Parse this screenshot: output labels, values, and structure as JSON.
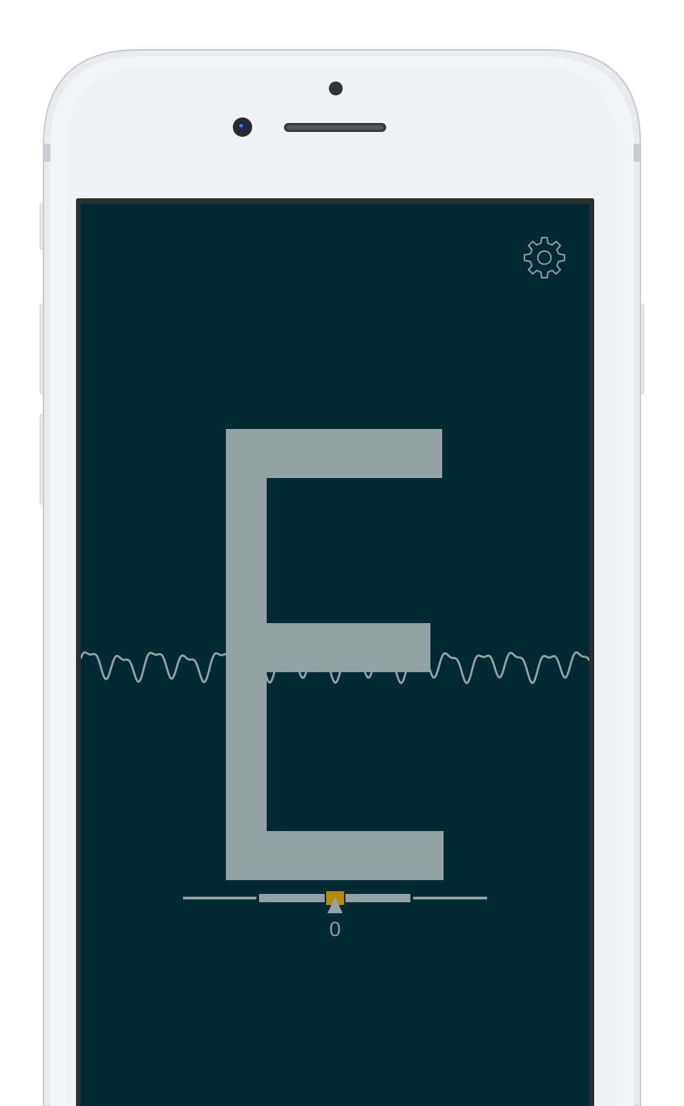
{
  "app": {
    "note": "E",
    "cents": "0",
    "icons": {
      "settings": "gear-icon",
      "indicator": "triangle-up-icon"
    },
    "colors": {
      "background": "#022a35",
      "foreground": "#93a2a2",
      "accent": "#b58900"
    }
  }
}
